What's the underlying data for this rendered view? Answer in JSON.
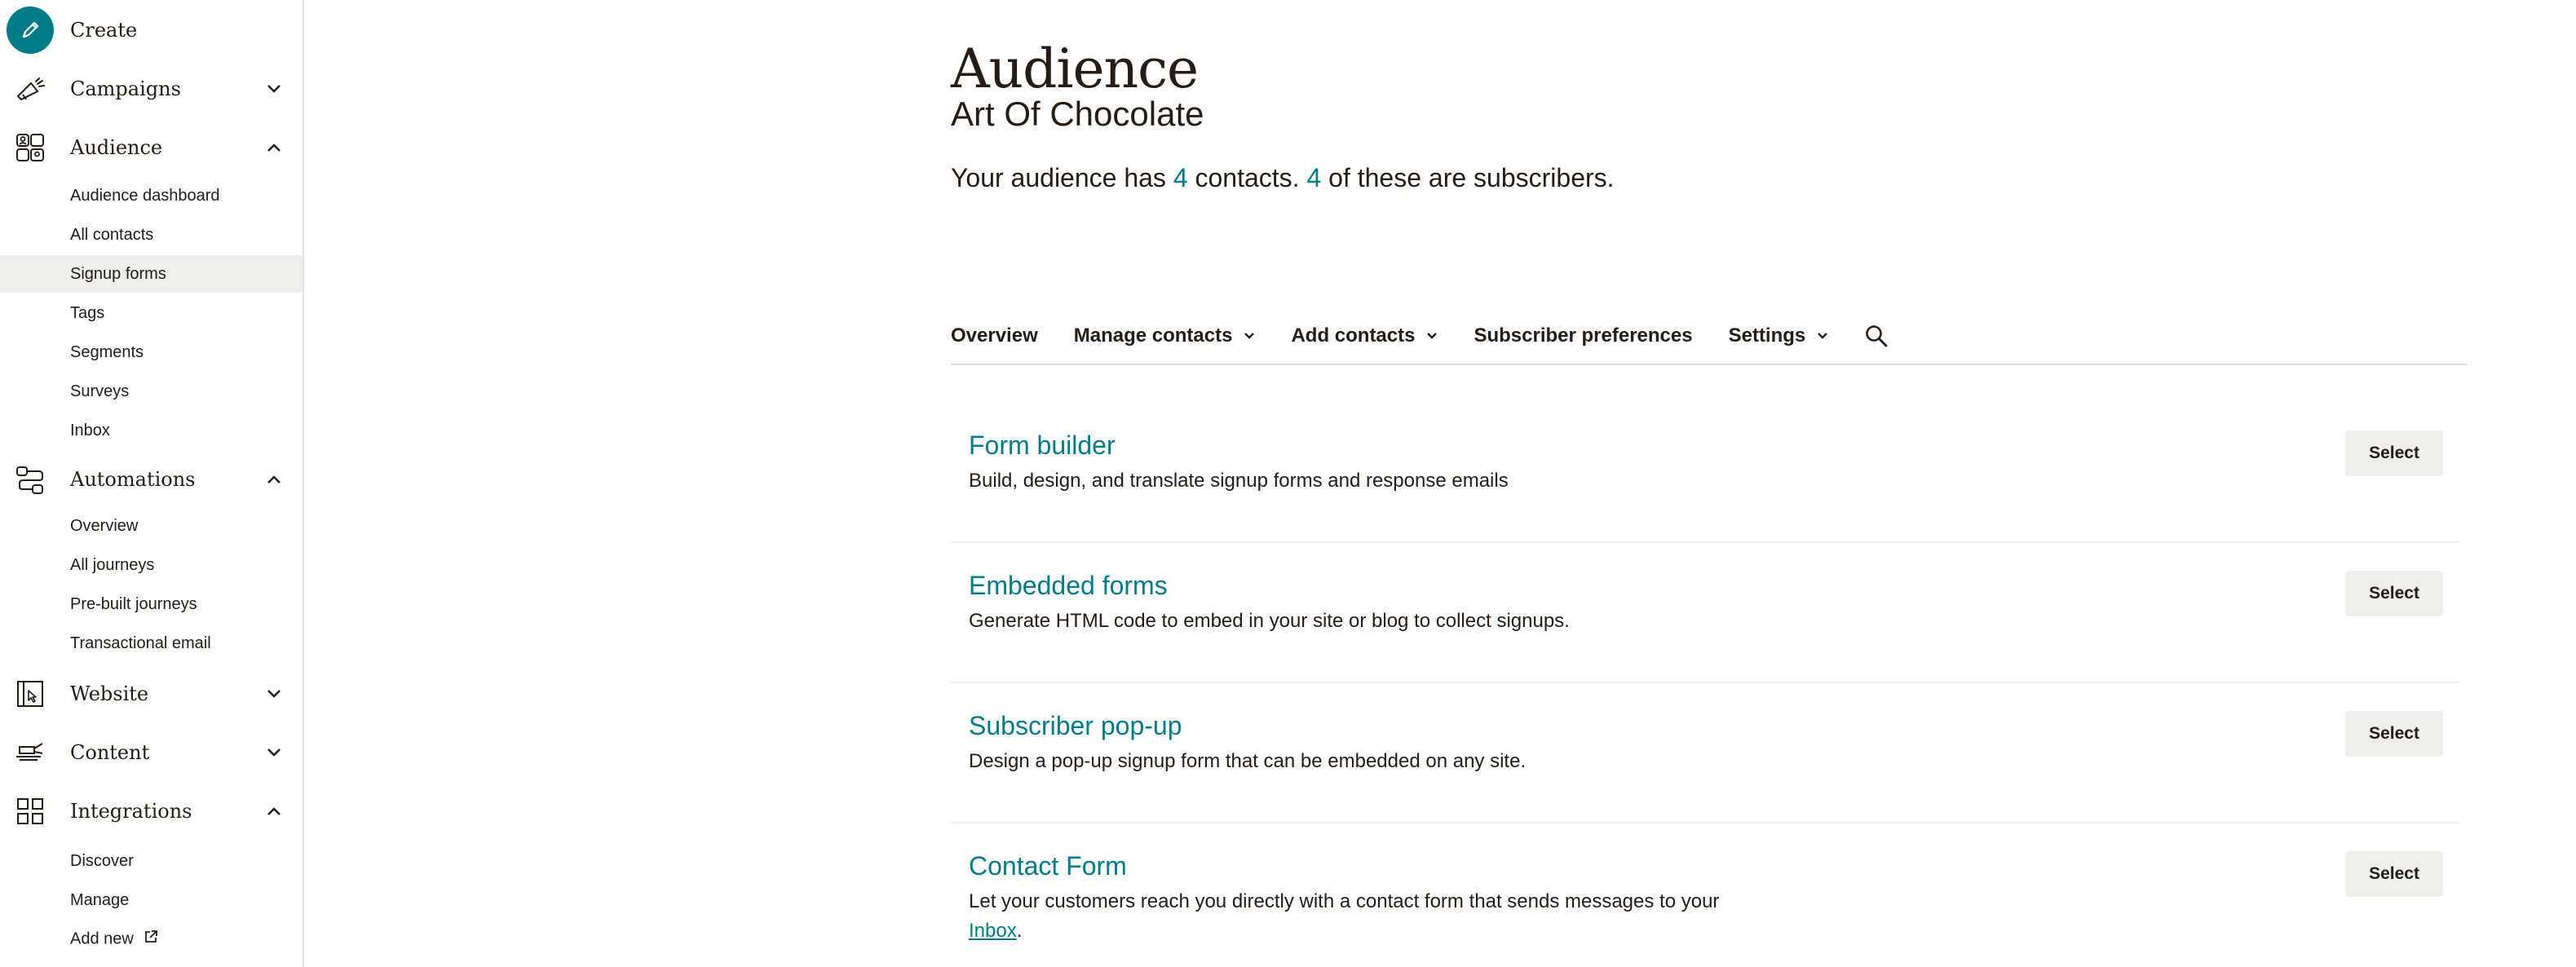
{
  "sidebar": {
    "create_label": "Create",
    "items": [
      {
        "label": "Campaigns"
      },
      {
        "label": "Audience"
      },
      {
        "label": "Automations"
      },
      {
        "label": "Website"
      },
      {
        "label": "Content"
      },
      {
        "label": "Integrations"
      }
    ],
    "audience_sub": [
      "Audience dashboard",
      "All contacts",
      "Signup forms",
      "Tags",
      "Segments",
      "Surveys",
      "Inbox"
    ],
    "automations_sub": [
      "Overview",
      "All journeys",
      "Pre-built journeys",
      "Transactional email"
    ],
    "integrations_sub": [
      "Discover",
      "Manage",
      "Add new"
    ],
    "active_sub": "Signup forms"
  },
  "header": {
    "title": "Audience",
    "audience_name": "Art Of Chocolate",
    "summary_pre": "Your audience has ",
    "contacts_count": "4",
    "summary_mid": " contacts. ",
    "subscribers_count": "4",
    "summary_post": " of these are subscribers."
  },
  "tabs": [
    {
      "label": "Overview"
    },
    {
      "label": "Manage contacts"
    },
    {
      "label": "Add contacts"
    },
    {
      "label": "Subscriber preferences"
    },
    {
      "label": "Settings"
    }
  ],
  "forms": [
    {
      "title": "Form builder",
      "description": "Build, design, and translate signup forms and response emails",
      "button": "Select"
    },
    {
      "title": "Embedded forms",
      "description": "Generate HTML code to embed in your site or blog to collect signups.",
      "button": "Select"
    },
    {
      "title": "Subscriber pop-up",
      "description": "Design a pop-up signup form that can be embedded on any site.",
      "button": "Select"
    },
    {
      "title": "Contact Form",
      "description_pre": "Let your customers reach you directly with a contact form that sends messages to your ",
      "description_link": "Inbox",
      "description_post": ".",
      "button": "Select"
    }
  ],
  "colors": {
    "accent": "#007c89",
    "text": "#241c15",
    "button_bg": "#efeeea",
    "active_bg": "#efeeea"
  }
}
